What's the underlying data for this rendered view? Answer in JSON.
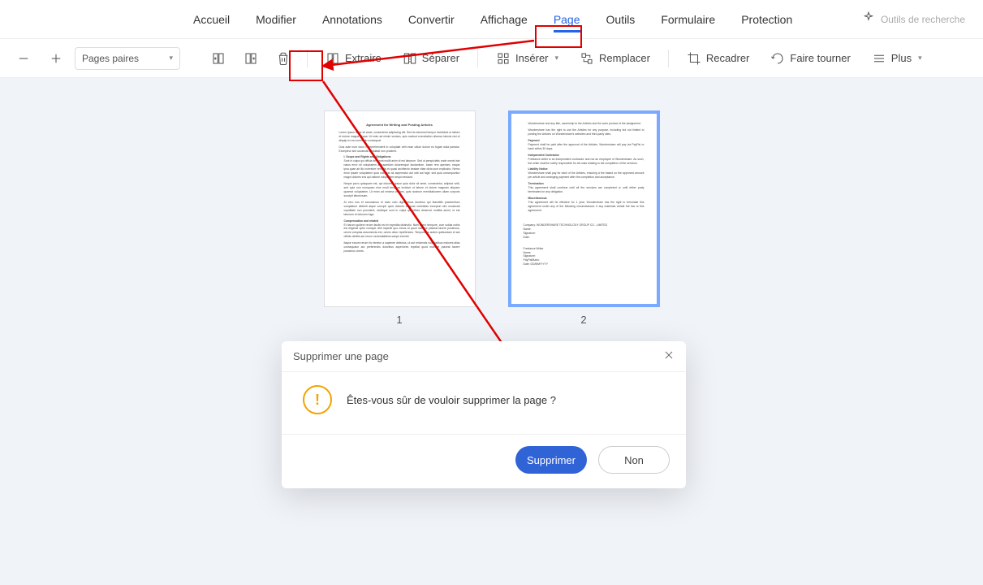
{
  "menu": {
    "items": [
      {
        "label": "Accueil"
      },
      {
        "label": "Modifier"
      },
      {
        "label": "Annotations"
      },
      {
        "label": "Convertir"
      },
      {
        "label": "Affichage"
      },
      {
        "label": "Page",
        "active": true
      },
      {
        "label": "Outils"
      },
      {
        "label": "Formulaire"
      },
      {
        "label": "Protection"
      }
    ],
    "search_hint": "Outils de recherche"
  },
  "toolbar": {
    "page_select": "Pages paires",
    "extract": "Extraire",
    "split": "Séparer",
    "insert": "Insérer",
    "replace": "Remplacer",
    "crop": "Recadrer",
    "rotate": "Faire tourner",
    "more": "Plus"
  },
  "pages": {
    "p1_label": "1",
    "p2_label": "2"
  },
  "dialog": {
    "title": "Supprimer une page",
    "message": "Êtes-vous sûr de vouloir supprimer la page ?",
    "confirm": "Supprimer",
    "cancel": "Non"
  }
}
